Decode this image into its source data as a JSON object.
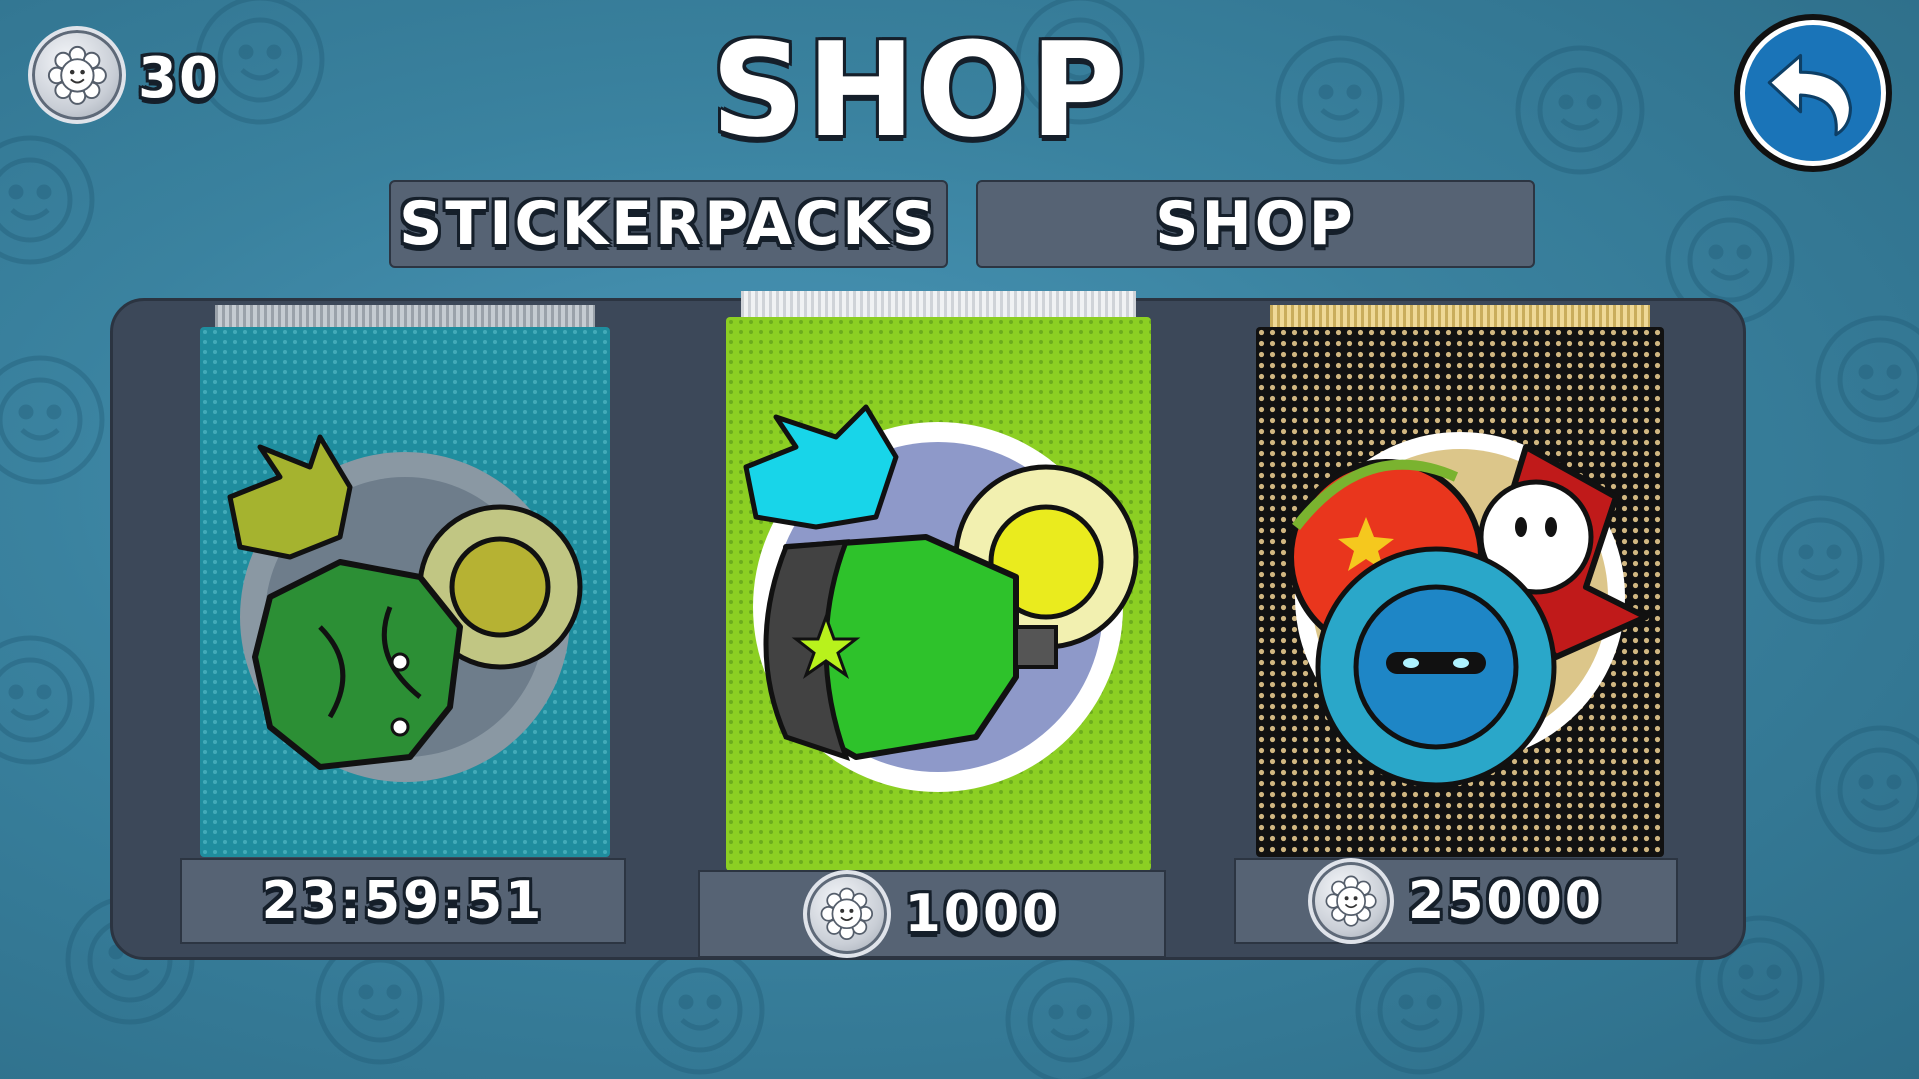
{
  "header": {
    "title": "SHOP",
    "currency_amount": "30"
  },
  "tabs": [
    {
      "label": "STICKERPACKS"
    },
    {
      "label": "SHOP"
    }
  ],
  "packs": [
    {
      "name": "standard-pack",
      "price_text": "23:59:51",
      "background": "#1f8d9e",
      "crimp": "#b8bfc6"
    },
    {
      "name": "green-pack",
      "price_text": "1000",
      "background": "#8ccf23",
      "crimp": "#e5e7ea"
    },
    {
      "name": "gold-pack",
      "price_text": "25000",
      "background": "#111111",
      "crimp": "#d8c07a"
    }
  ],
  "colors": {
    "accent_blue": "#1a74b8",
    "panel": "#3c4859",
    "tab": "#566374"
  }
}
